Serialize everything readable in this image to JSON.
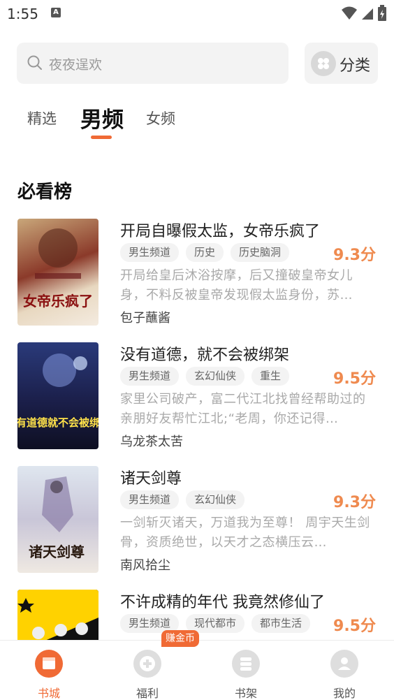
{
  "status_bar": {
    "time": "1:55",
    "indicator": "A"
  },
  "search": {
    "placeholder": "夜夜逞欢"
  },
  "category": {
    "label": "分类"
  },
  "tabs": [
    {
      "label": "精选",
      "active": false
    },
    {
      "label": "男频",
      "active": true
    },
    {
      "label": "女频",
      "active": false
    }
  ],
  "section": {
    "title": "必看榜"
  },
  "books": [
    {
      "title": "开局自曝假太监，女帝乐疯了",
      "tags": [
        "男生频道",
        "历史",
        "历史脑洞"
      ],
      "score": "9.3分",
      "desc": "开局给皇后沐浴按摩，后又撞破皇帝女儿身，不料反被皇帝发现假太监身份，苏…",
      "author": "包子蘸酱",
      "cover_text": "女帝乐疯了"
    },
    {
      "title": "没有道德，就不会被绑架",
      "tags": [
        "男生频道",
        "玄幻仙侠",
        "重生"
      ],
      "score": "9.5分",
      "desc": "家里公司破产，富二代江北找曾经帮助过的亲朋好友帮忙江北;“老周，你还记得…",
      "author": "乌龙茶太苦",
      "cover_text": "没有道德就不会被绑架"
    },
    {
      "title": "诸天剑尊",
      "tags": [
        "男生频道",
        "玄幻仙侠"
      ],
      "score": "9.3分",
      "desc": "一剑斩灭诸天，万道我为至尊！ 周宇天生剑骨，资质绝世，以天才之态横压云…",
      "author": "南风拾尘",
      "cover_text": "诸天剑尊"
    },
    {
      "title": "不许成精的年代 我竟然修仙了",
      "tags": [
        "男生频道",
        "现代都市",
        "都市生活"
      ],
      "score": "9.5分",
      "desc": "",
      "author": "",
      "cover_text": ""
    }
  ],
  "bottom_nav": [
    {
      "label": "书城",
      "active": true
    },
    {
      "label": "福利",
      "active": false
    },
    {
      "label": "书架",
      "active": false
    },
    {
      "label": "我的",
      "active": false
    }
  ],
  "earn_badge": "赚金币",
  "colors": {
    "accent": "#f06a35",
    "score": "#ef8a4f",
    "chip_bg": "#f3f3f3"
  }
}
